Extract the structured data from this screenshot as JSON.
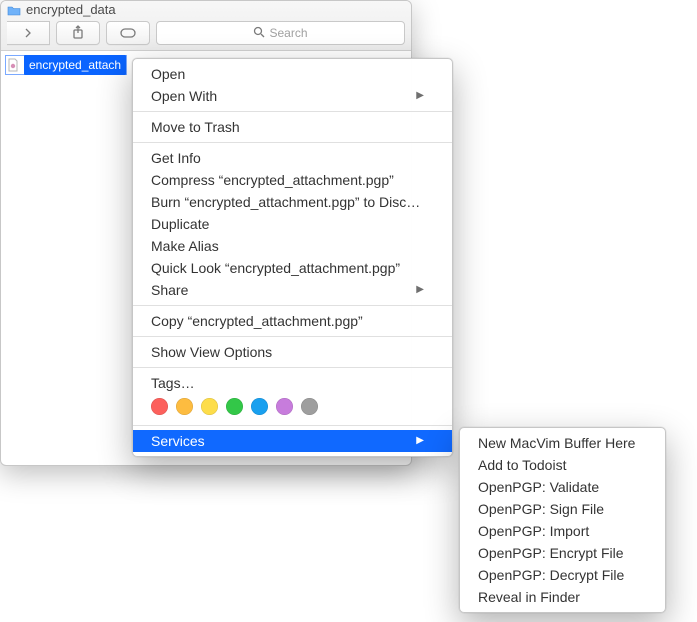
{
  "window": {
    "title": "encrypted_data"
  },
  "search": {
    "placeholder": "Search"
  },
  "file": {
    "name": "encrypted_attachment.pgp",
    "display_truncated": "encrypted_attach"
  },
  "menu": {
    "open": "Open",
    "open_with": "Open With",
    "move_to_trash": "Move to Trash",
    "get_info": "Get Info",
    "compress": "Compress “encrypted_attachment.pgp”",
    "burn": "Burn “encrypted_attachment.pgp” to Disc…",
    "duplicate": "Duplicate",
    "make_alias": "Make Alias",
    "quick_look": "Quick Look “encrypted_attachment.pgp”",
    "share": "Share",
    "copy": "Copy “encrypted_attachment.pgp”",
    "show_view_options": "Show View Options",
    "tags": "Tags…",
    "services": "Services"
  },
  "tag_colors": [
    "#fc605c",
    "#fdbc40",
    "#fddd4a",
    "#33c748",
    "#19a0ef",
    "#c77cdc",
    "#9e9e9e"
  ],
  "services_submenu": [
    "New MacVim Buffer Here",
    "Add to Todoist",
    "OpenPGP: Validate",
    "OpenPGP: Sign File",
    "OpenPGP: Import",
    "OpenPGP: Encrypt File",
    "OpenPGP: Decrypt File",
    "Reveal in Finder"
  ]
}
